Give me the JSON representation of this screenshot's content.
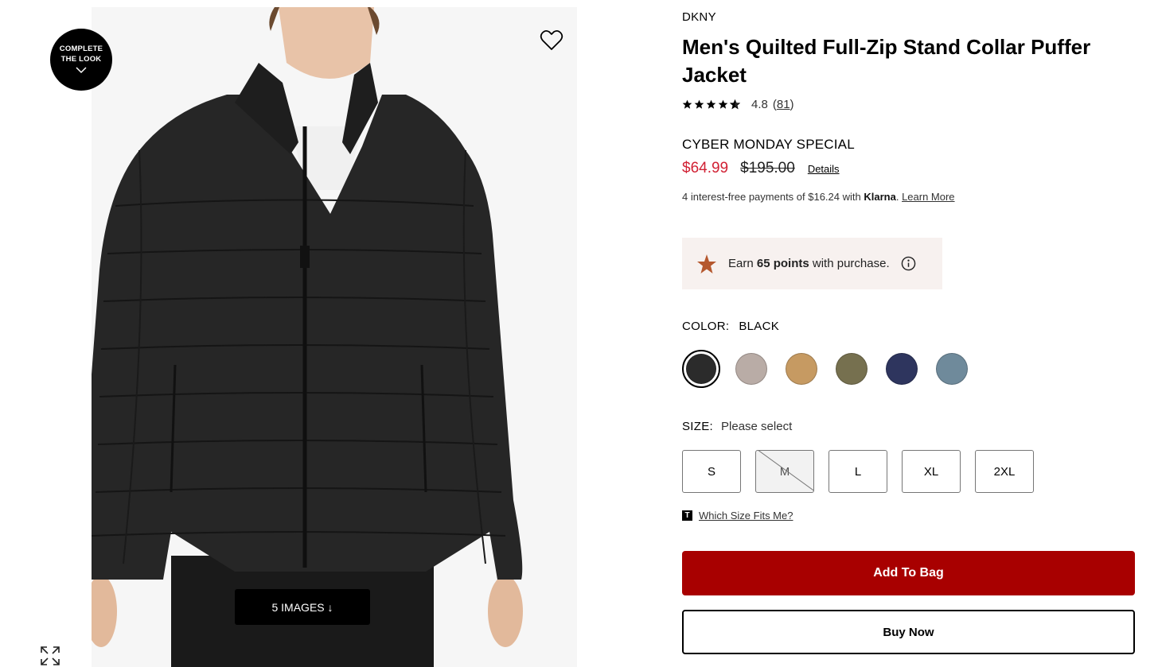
{
  "gallery": {
    "complete_look_line1": "COMPLETE",
    "complete_look_line2": "THE LOOK",
    "images_button": "5 IMAGES ↓"
  },
  "product": {
    "brand": "DKNY",
    "title": "Men's Quilted Full-Zip Stand Collar Puffer Jacket",
    "rating_value": "4.8",
    "rating_stars": 4.8,
    "review_count": "81",
    "promo_label": "CYBER MONDAY SPECIAL",
    "sale_price": "$64.99",
    "original_price": "$195.00",
    "details_link": "Details",
    "klarna_prefix": "4 interest-free payments of $16.24 with ",
    "klarna_brand": "Klarna",
    "klarna_learn_more": "Learn More",
    "points_prefix": "Earn ",
    "points_value": "65 points",
    "points_suffix": " with purchase."
  },
  "color": {
    "label": "COLOR:",
    "selected": "BLACK",
    "swatches": [
      {
        "name": "black",
        "hex": "#2b2b2b"
      },
      {
        "name": "oatmeal heather",
        "hex": "#b9aca6"
      },
      {
        "name": "camel",
        "hex": "#c69a62"
      },
      {
        "name": "olive",
        "hex": "#76704f"
      },
      {
        "name": "navy",
        "hex": "#2e355e"
      },
      {
        "name": "slate blue",
        "hex": "#6f8a9b"
      }
    ]
  },
  "size": {
    "label": "SIZE:",
    "value": "Please select",
    "options": [
      {
        "label": "S",
        "available": true
      },
      {
        "label": "M",
        "available": false
      },
      {
        "label": "L",
        "available": true
      },
      {
        "label": "XL",
        "available": true
      },
      {
        "label": "2XL",
        "available": true
      }
    ],
    "fit_link": "Which Size Fits Me?"
  },
  "actions": {
    "add_to_bag": "Add To Bag",
    "buy_now": "Buy Now"
  },
  "colors": {
    "sale_red": "#d12134",
    "add_to_bag_bg": "#a80000",
    "points_bg": "#f7f1ef",
    "points_star": "#b5582e"
  }
}
